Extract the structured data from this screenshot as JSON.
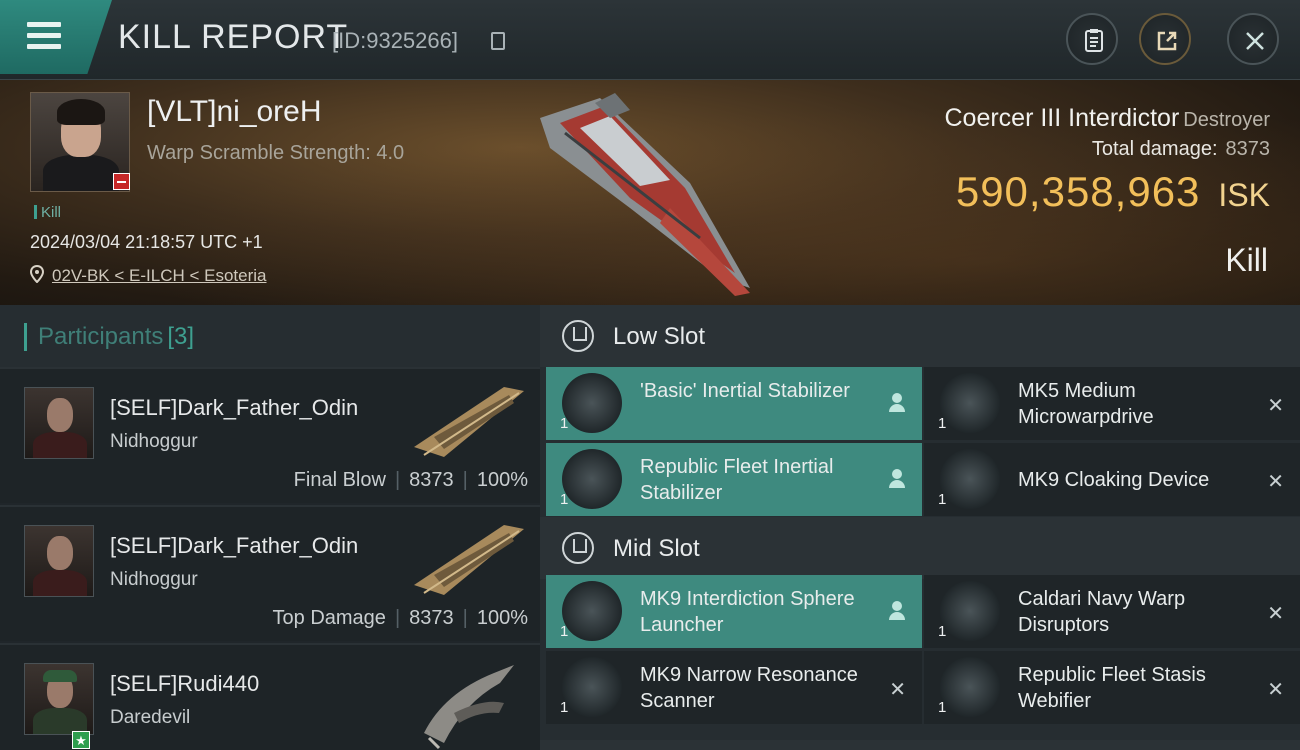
{
  "header": {
    "title": "KILL REPORT",
    "id_text": "[ID:9325266]"
  },
  "victim": {
    "name": "[VLT]ni_oreH",
    "warp_scramble": "Warp Scramble Strength: 4.0",
    "tag": "Kill",
    "datetime": "2024/03/04 21:18:57 UTC +1",
    "location": "02V-BK < E-ILCH < Esoteria",
    "ship_name": "Coercer III Interdictor",
    "ship_class": "Destroyer",
    "total_damage_label": "Total damage:",
    "total_damage": "8373",
    "isk_value": "590,358,963",
    "isk_unit": "ISK",
    "result": "Kill"
  },
  "participants": {
    "title": "Participants",
    "count": "[3]",
    "rows": [
      {
        "name": "[SELF]Dark_Father_Odin",
        "ship": "Nidhoggur",
        "role": "Final Blow",
        "damage": "8373",
        "percent": "100%"
      },
      {
        "name": "[SELF]Dark_Father_Odin",
        "ship": "Nidhoggur",
        "role": "Top Damage",
        "damage": "8373",
        "percent": "100%"
      },
      {
        "name": "[SELF]Rudi440",
        "ship": "Daredevil"
      }
    ]
  },
  "fittings": {
    "low_slot": {
      "title": "Low Slot",
      "items": [
        {
          "name": "'Basic' Inertial Stabilizer",
          "qty": "1"
        },
        {
          "name": "MK5 Medium Microwarpdrive",
          "qty": "1"
        },
        {
          "name": "Republic Fleet Inertial Stabilizer",
          "qty": "1"
        },
        {
          "name": "MK9 Cloaking Device",
          "qty": "1"
        }
      ]
    },
    "mid_slot": {
      "title": "Mid Slot",
      "items": [
        {
          "name": "MK9 Interdiction Sphere Launcher",
          "qty": "1"
        },
        {
          "name": "Caldari Navy Warp Disruptors",
          "qty": "1"
        },
        {
          "name": "MK9 Narrow Resonance Scanner",
          "qty": "1"
        },
        {
          "name": "Republic Fleet Stasis Webifier",
          "qty": "1"
        }
      ]
    }
  },
  "colors": {
    "accent": "#3ea090",
    "isk": "#f2bf5a",
    "active_item": "#3e8a7f"
  }
}
